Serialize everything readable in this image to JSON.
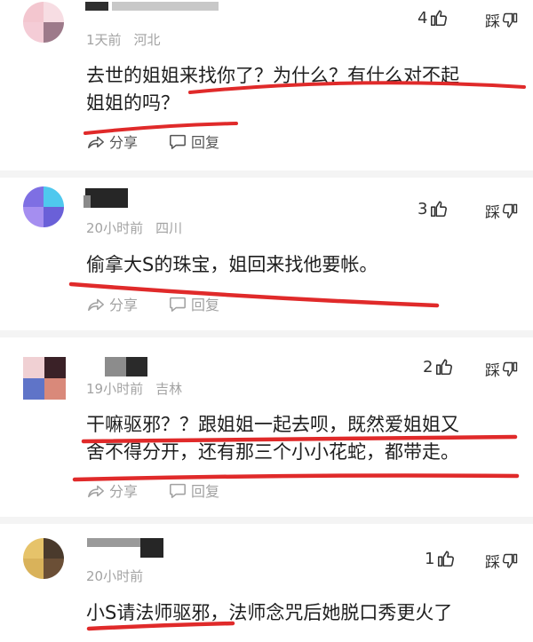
{
  "comments": [
    {
      "time": "1天前",
      "location": "河北",
      "likes": "4",
      "dislike_label": "踩",
      "text_lines": [
        "去世的姐姐来找你了？为什么？有什么对不起",
        "姐姐的吗？"
      ],
      "share_label": "分享",
      "reply_label": "回复"
    },
    {
      "time": "20小时前",
      "location": "四川",
      "likes": "3",
      "dislike_label": "踩",
      "text_lines": [
        "偷拿大S的珠宝，姐回来找他要帐。"
      ],
      "share_label": "分享",
      "reply_label": "回复"
    },
    {
      "time": "19小时前",
      "location": "吉林",
      "likes": "2",
      "dislike_label": "踩",
      "text_lines": [
        "干嘛驱邪？？跟姐姐一起去呗，既然爱姐姐又",
        "舍不得分开，还有那三个小小花蛇，都带走。"
      ],
      "share_label": "分享",
      "reply_label": "回复"
    },
    {
      "time": "20小时前",
      "location": "",
      "likes": "1",
      "dislike_label": "踩",
      "text_lines": [
        "小S请法师驱邪，法师念咒后她脱口秀更火了"
      ],
      "share_label": "",
      "reply_label": ""
    }
  ],
  "colors": {
    "annotation_red": "#e02a2a",
    "meta_gray": "#a3a3a3",
    "divider_gray": "#f4f4f4"
  },
  "icons": {
    "like": "thumbs-up-icon",
    "dislike": "thumbs-down-icon",
    "share": "share-icon",
    "reply": "reply-bubble-icon"
  }
}
